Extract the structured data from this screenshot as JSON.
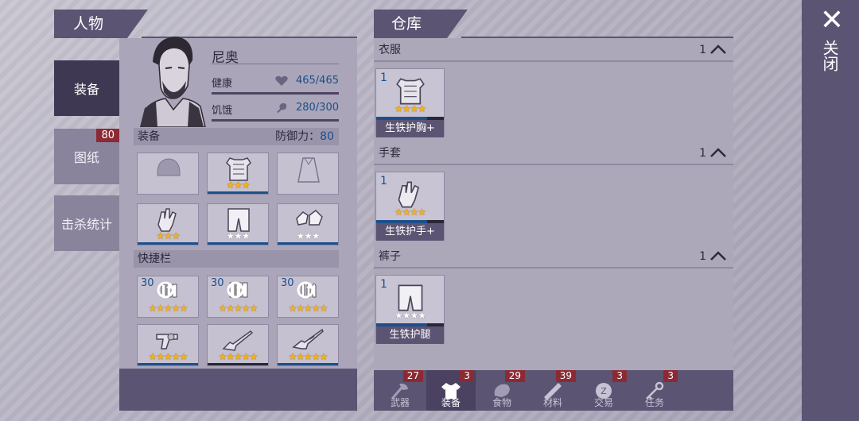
{
  "character_panel": {
    "title": "人物",
    "tabs": [
      {
        "label": "装备",
        "badge": ""
      },
      {
        "label": "图纸",
        "badge": "80"
      },
      {
        "label": "击杀统计",
        "badge": ""
      }
    ],
    "name": "尼奥",
    "health": {
      "label": "健康",
      "value": "465/465"
    },
    "hunger": {
      "label": "饥饿",
      "value": "280/300"
    },
    "equipment": {
      "label": "装备",
      "defense_label": "防御力：",
      "defense_value": "80"
    },
    "quickbar": {
      "label": "快捷栏"
    },
    "equip_slots": [
      {
        "icon": "helmet-icon",
        "stars": 0
      },
      {
        "icon": "chest-armor-icon",
        "stars": 3,
        "color": "gold"
      },
      {
        "icon": "cloak-icon",
        "stars": 0
      },
      {
        "icon": "gloves-icon",
        "stars": 3,
        "color": "gold"
      },
      {
        "icon": "pants-icon",
        "stars": 3,
        "color": "white"
      },
      {
        "icon": "boots-icon",
        "stars": 3,
        "color": "white"
      }
    ],
    "quick_slots": [
      {
        "icon": "ammo-icon",
        "qty": "30",
        "stars": 5
      },
      {
        "icon": "ammo-icon",
        "qty": "30",
        "stars": 5
      },
      {
        "icon": "bullets-icon",
        "qty": "30",
        "stars": 5
      },
      {
        "icon": "revolver-icon",
        "qty": "",
        "stars": 5
      },
      {
        "icon": "shotgun-icon",
        "qty": "",
        "stars": 5
      },
      {
        "icon": "rifle-icon",
        "qty": "",
        "stars": 5
      }
    ]
  },
  "warehouse_panel": {
    "title": "仓库",
    "categories": [
      {
        "label": "衣服",
        "count": "1",
        "item": {
          "qty": "1",
          "name": "生铁护胸+",
          "stars": 4,
          "color": "gold",
          "progress": 0.75,
          "icon": "chest-armor-icon"
        }
      },
      {
        "label": "手套",
        "count": "1",
        "item": {
          "qty": "1",
          "name": "生铁护手+",
          "stars": 4,
          "color": "gold",
          "progress": 0.75,
          "icon": "gloves-icon"
        }
      },
      {
        "label": "裤子",
        "count": "1",
        "item": {
          "qty": "1",
          "name": "生铁护腿",
          "stars": 4,
          "color": "white",
          "progress": 0.75,
          "icon": "pants-icon"
        }
      }
    ],
    "bottom_tabs": [
      {
        "label": "武器",
        "badge": "27",
        "icon": "axe-icon"
      },
      {
        "label": "装备",
        "badge": "3",
        "icon": "shirt-icon"
      },
      {
        "label": "食物",
        "badge": "29",
        "icon": "meat-icon"
      },
      {
        "label": "材料",
        "badge": "39",
        "icon": "plank-icon"
      },
      {
        "label": "交易",
        "badge": "3",
        "icon": "coin-icon"
      },
      {
        "label": "任务",
        "badge": "3",
        "icon": "key-icon"
      }
    ]
  },
  "close": {
    "symbol": "✕",
    "label": "关闭"
  }
}
